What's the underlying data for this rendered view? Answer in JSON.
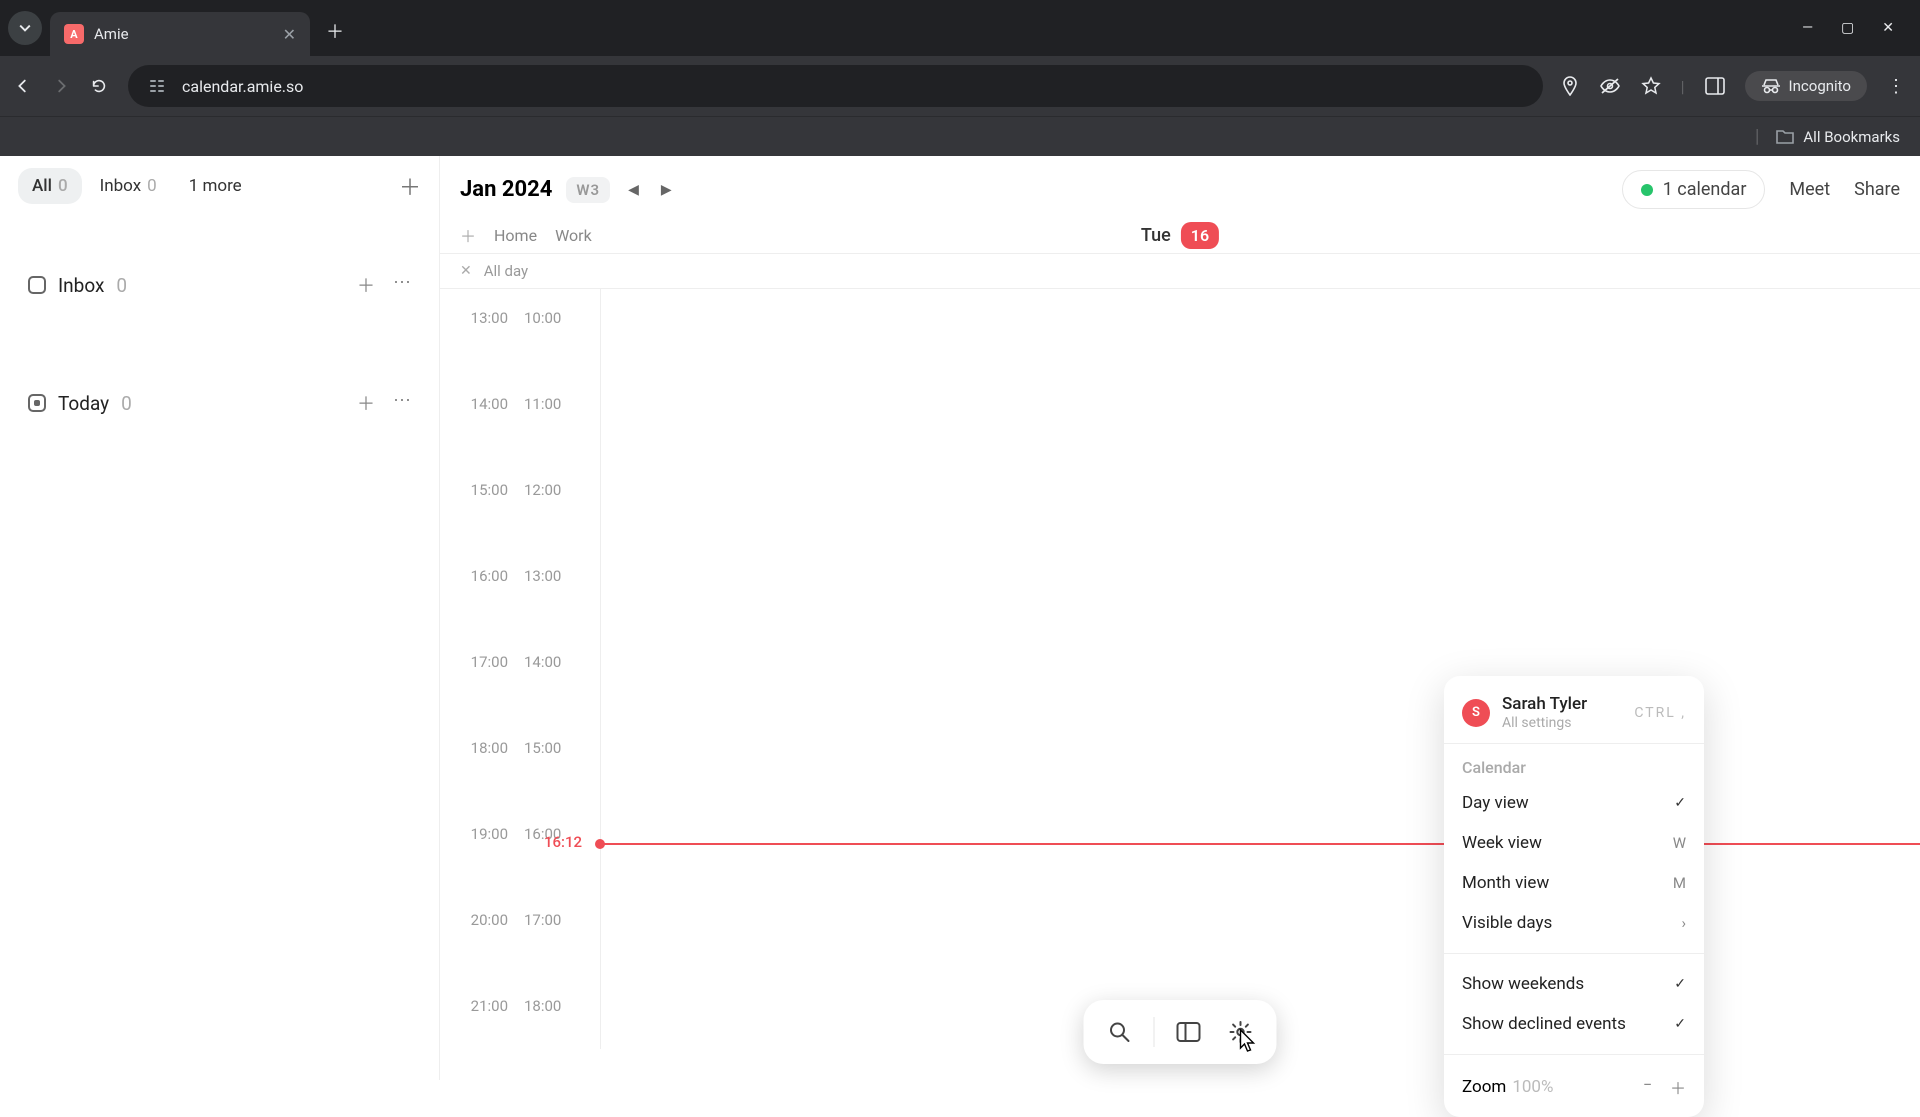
{
  "browser": {
    "tab_title": "Amie",
    "favicon_letter": "A",
    "url": "calendar.amie.so",
    "incognito_label": "Incognito",
    "bookmarks_label": "All Bookmarks"
  },
  "sidebar": {
    "tabs": [
      {
        "label": "All",
        "count": "0",
        "active": true
      },
      {
        "label": "Inbox",
        "count": "0",
        "active": false
      },
      {
        "label": "1 more",
        "count": "",
        "active": false
      }
    ],
    "lists": [
      {
        "label": "Inbox",
        "count": "0"
      },
      {
        "label": "Today",
        "count": "0"
      }
    ]
  },
  "calendar": {
    "month_label": "Jan 2024",
    "week_badge": "W3",
    "day_name": "Tue",
    "day_number": "16",
    "tabs": [
      "Home",
      "Work"
    ],
    "allday_label": "All day",
    "calendar_count_label": "1 calendar",
    "meet_label": "Meet",
    "share_label": "Share",
    "now_time": "16:12",
    "time_rows": [
      {
        "left": "13:00",
        "right": "10:00"
      },
      {
        "left": "14:00",
        "right": "11:00"
      },
      {
        "left": "15:00",
        "right": "12:00"
      },
      {
        "left": "16:00",
        "right": "13:00"
      },
      {
        "left": "17:00",
        "right": "14:00"
      },
      {
        "left": "18:00",
        "right": "15:00"
      },
      {
        "left": "19:00",
        "right": "16:00"
      },
      {
        "left": "20:00",
        "right": "17:00"
      },
      {
        "left": "21:00",
        "right": "18:00"
      }
    ]
  },
  "settings_menu": {
    "user_name": "Sarah Tyler",
    "user_initial": "S",
    "user_subtitle": "All settings",
    "user_shortcut": "CTRL ,",
    "section_label": "Calendar",
    "items": [
      {
        "label": "Day view",
        "right_type": "check"
      },
      {
        "label": "Week view",
        "right_type": "key",
        "right": "W"
      },
      {
        "label": "Month view",
        "right_type": "key",
        "right": "M"
      },
      {
        "label": "Visible days",
        "right_type": "chevron"
      }
    ],
    "toggles": [
      {
        "label": "Show weekends",
        "checked": true
      },
      {
        "label": "Show declined events",
        "checked": true
      }
    ],
    "zoom_label": "Zoom",
    "zoom_value": "100%"
  }
}
